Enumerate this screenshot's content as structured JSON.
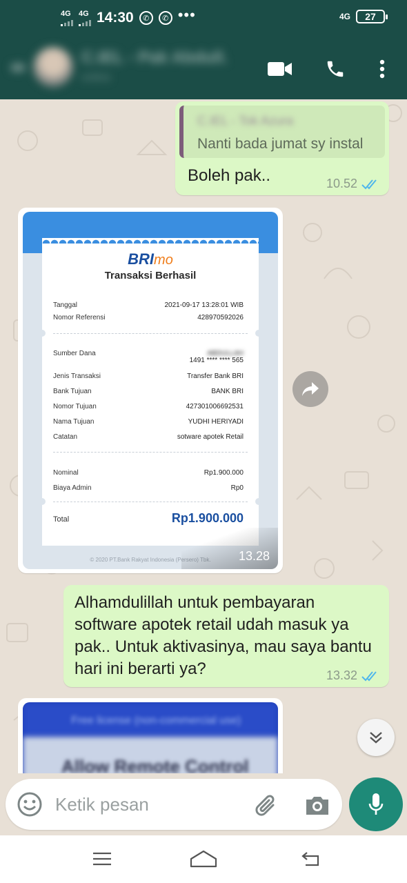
{
  "status_bar": {
    "network_1": "4G",
    "network_2": "4G",
    "time": "14:30",
    "overflow": "•••",
    "network_right": "4G",
    "battery": "27"
  },
  "header": {
    "contact_name": "C.IEL - Pak Abdull.",
    "contact_sub": "online",
    "icons": [
      "video-call-icon",
      "phone-icon",
      "more-options-icon"
    ]
  },
  "messages": [
    {
      "direction": "outgoing",
      "quote_name": "C.IEL - Tok Azura",
      "quote_text": "Nanti bada jumat sy instal",
      "text": "Boleh pak..",
      "time": "10.52",
      "status": "read"
    },
    {
      "direction": "incoming",
      "type": "image",
      "time": "13.28",
      "receipt": {
        "logo_main": "BRI",
        "logo_sub": "mo",
        "title": "Transaksi Berhasil",
        "rows_top": [
          {
            "label": "Tanggal",
            "value": "2021-09-17 13:28:01 WIB"
          },
          {
            "label": "Nomor Referensi",
            "value": "428970592026"
          }
        ],
        "source_label": "Sumber Dana",
        "source_name": "ABDULLAH",
        "source_value": "1491 **** **** 565",
        "rows_mid": [
          {
            "label": "Jenis Transaksi",
            "value": "Transfer Bank BRI"
          },
          {
            "label": "Bank Tujuan",
            "value": "BANK BRI"
          },
          {
            "label": "Nomor Tujuan",
            "value": "427301006692531"
          },
          {
            "label": "Nama Tujuan",
            "value": "YUDHI HERIYADI"
          },
          {
            "label": "Catatan",
            "value": "sotware apotek Retail"
          }
        ],
        "rows_amount": [
          {
            "label": "Nominal",
            "value": "Rp1.900.000"
          },
          {
            "label": "Biaya Admin",
            "value": "Rp0"
          }
        ],
        "total_label": "Total",
        "total_value": "Rp1.900.000",
        "footer": "© 2020 PT.Bank Rakyat Indonesia (Persero) Tbk."
      }
    },
    {
      "direction": "outgoing",
      "text": "Alhamdulillah untuk pembayaran software apotek retail udah masuk ya pak.. Untuk aktivasinya, mau saya bantu hari ini berarti ya?",
      "time": "13.32",
      "status": "read"
    },
    {
      "direction": "incoming",
      "type": "image",
      "preview_text_1": "Free license (non-commercial use)",
      "preview_text_2": "Allow Remote Control"
    }
  ],
  "composer": {
    "placeholder": "Ketik pesan",
    "icons": [
      "emoji-icon",
      "attach-icon",
      "camera-icon",
      "mic-icon"
    ]
  },
  "colors": {
    "header": "#1b4d47",
    "outgoing_bubble": "#dcf8c6",
    "incoming_bubble": "#ffffff",
    "read_ticks": "#4fb6ec",
    "mic_button": "#1e8a78",
    "chat_background": "#e8e0d6"
  }
}
